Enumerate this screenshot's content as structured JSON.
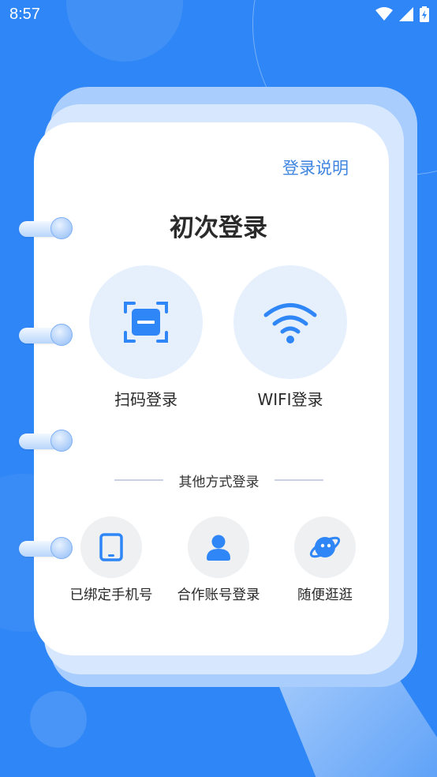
{
  "status_bar": {
    "time": "8:57"
  },
  "header": {
    "help_link": "登录说明",
    "title": "初次登录"
  },
  "primary_options": [
    {
      "label": "扫码登录",
      "icon": "scan-icon"
    },
    {
      "label": "WIFI登录",
      "icon": "wifi-icon"
    }
  ],
  "divider": {
    "label": "其他方式登录"
  },
  "other_options": [
    {
      "label": "已绑定手机号",
      "icon": "phone-icon"
    },
    {
      "label": "合作账号登录",
      "icon": "user-icon"
    },
    {
      "label": "随便逛逛",
      "icon": "planet-icon"
    }
  ],
  "colors": {
    "background": "#2f86f6",
    "accent": "#2f86f6",
    "link": "#3f85e0"
  }
}
